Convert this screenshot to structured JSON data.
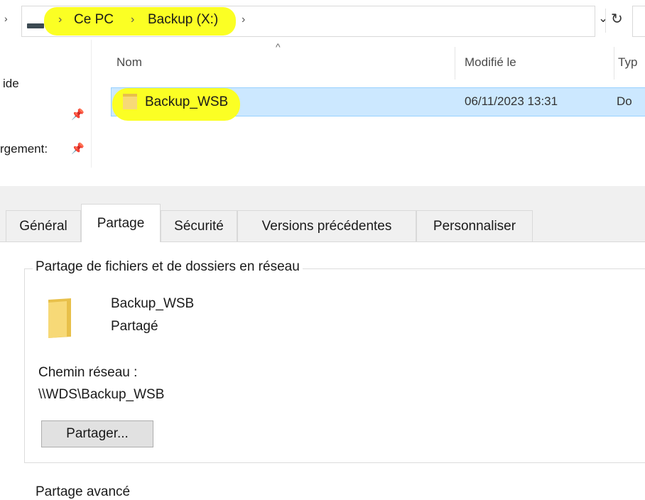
{
  "explorer": {
    "breadcrumb": {
      "this_pc": "Ce PC",
      "drive": "Backup (X:)"
    },
    "nav_pane": {
      "item1": "ide",
      "item2": "rgement:"
    },
    "columns": {
      "name": "Nom",
      "modified": "Modifié le",
      "type": "Typ"
    },
    "rows": [
      {
        "name": "Backup_WSB",
        "modified": "06/11/2023 13:31",
        "type": "Do"
      }
    ],
    "highlight_color": "#fbff24",
    "selection_color": "#cce8ff"
  },
  "properties": {
    "tabs": [
      "Général",
      "Partage",
      "Sécurité",
      "Versions précédentes",
      "Personnaliser"
    ],
    "active_tab": "Partage",
    "group_title": "Partage de fichiers et de dossiers en réseau",
    "folder_name": "Backup_WSB",
    "share_state": "Partagé",
    "network_path_label": "Chemin réseau :",
    "network_path": "\\\\WDS\\Backup_WSB",
    "share_button": "Partager...",
    "advanced_title": "Partage avancé"
  }
}
